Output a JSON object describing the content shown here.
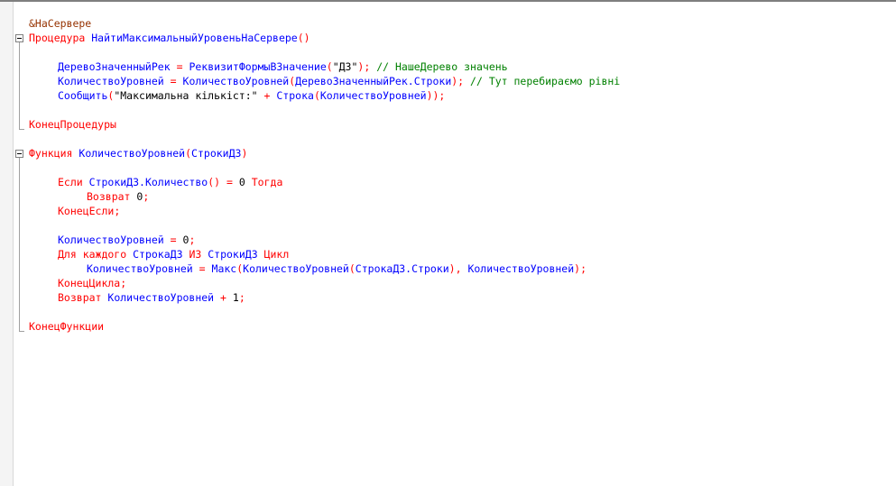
{
  "code": {
    "l1_directive": "&НаСервере",
    "l2_kw": "Процедура",
    "l2_name": "НайтиМаксимальныйУровеньНаСервере",
    "l2_paren": "()",
    "l4_a": "ДеревоЗначенныйРек",
    "l4_b": "РеквизитФормыВЗначение",
    "l4_c": "\"ДЗ\"",
    "l4_comment": "// НашеДерево значень",
    "l5_a": "КоличествоУровней",
    "l5_b": "КоличествоУровней",
    "l5_c": "ДеревоЗначенныйРек.Строки",
    "l5_comment": "// Тут перебираємо рівні",
    "l6_a": "Сообщить",
    "l6_str": "\"Максимальна кількіст:\"",
    "l6_b": "Строка",
    "l6_c": "КоличествоУровней",
    "l8_end": "КонецПроцедуры",
    "l10_kw": "Функция",
    "l10_name": "КоличествоУровней",
    "l10_param": "СтрокиДЗ",
    "l12_if": "Если",
    "l12_a": "СтрокиДЗ.Количество",
    "l12_zero": "0",
    "l12_then": "Тогда",
    "l13_ret": "Возврат",
    "l13_val": "0",
    "l14_endif": "КонецЕсли",
    "l16_a": "КоличествоУровней",
    "l16_zero": "0",
    "l17_for": "Для каждого",
    "l17_a": "СтрокаДЗ",
    "l17_in": "ИЗ",
    "l17_b": "СтрокиДЗ",
    "l17_cycle": "Цикл",
    "l18_a": "КоличествоУровней",
    "l18_b": "Макс",
    "l18_c": "КоличествоУровней",
    "l18_d": "СтрокаДЗ.Строки",
    "l18_e": "КоличествоУровней",
    "l19_endcycle": "КонецЦикла",
    "l20_ret": "Возврат",
    "l20_a": "КоличествоУровней",
    "l20_one": "1",
    "l22_end": "КонецФункции"
  }
}
